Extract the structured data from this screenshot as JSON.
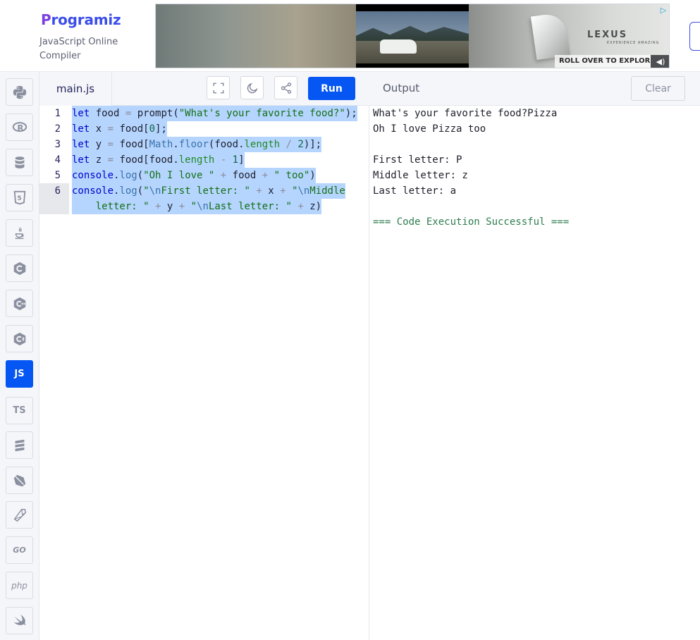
{
  "header": {
    "logo_text": "rogramiz",
    "logo_initial": "P",
    "subtitle": "JavaScript Online Compiler"
  },
  "ad": {
    "brand": "LEXUS",
    "brand_sub": "EXPERIENCE AMAZING",
    "cta": "ROLL OVER TO EXPLORE",
    "adchoices": "▷"
  },
  "sidebar": {
    "languages": [
      {
        "name": "python",
        "label": ""
      },
      {
        "name": "r",
        "label": ""
      },
      {
        "name": "sql",
        "label": ""
      },
      {
        "name": "html",
        "label": ""
      },
      {
        "name": "java",
        "label": ""
      },
      {
        "name": "c",
        "label": ""
      },
      {
        "name": "cpp",
        "label": ""
      },
      {
        "name": "csharp",
        "label": ""
      },
      {
        "name": "javascript",
        "label": "JS",
        "active": true
      },
      {
        "name": "typescript",
        "label": "TS"
      },
      {
        "name": "sql-server",
        "label": ""
      },
      {
        "name": "dart",
        "label": ""
      },
      {
        "name": "ruby",
        "label": ""
      },
      {
        "name": "go",
        "label": "GO"
      },
      {
        "name": "php",
        "label": "php"
      },
      {
        "name": "swift",
        "label": ""
      }
    ]
  },
  "editor": {
    "file_tab": "main.js",
    "run_label": "Run",
    "line_numbers": [
      "1",
      "2",
      "3",
      "4",
      "5",
      "6"
    ]
  },
  "output": {
    "title": "Output",
    "clear_label": "Clear",
    "lines": [
      "What's your favorite food?Pizza",
      "Oh I love Pizza too",
      "",
      "First letter: P",
      "Middle letter: z",
      "Last letter: a",
      ""
    ],
    "success": "=== Code Execution Successful ==="
  },
  "colors": {
    "accent": "#0556f3",
    "brand": "#3c4ee8"
  }
}
